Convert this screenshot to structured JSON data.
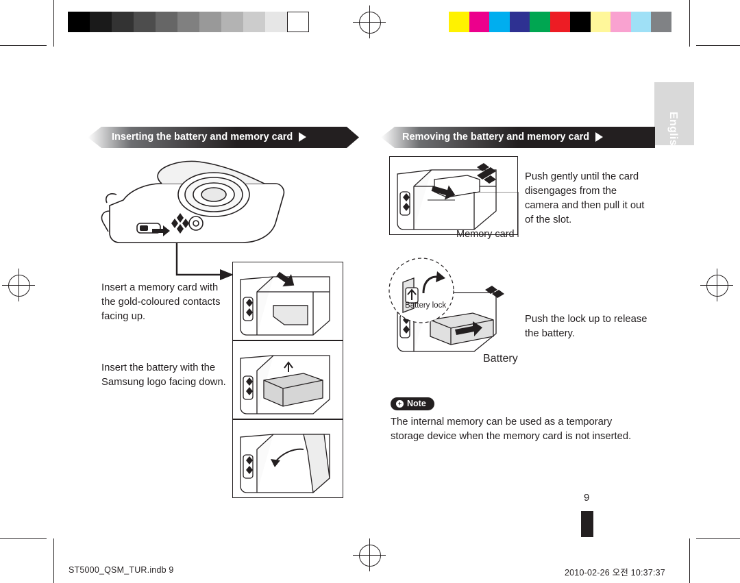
{
  "document": {
    "language_tab": "English",
    "page_number": "9",
    "footer_left": "ST5000_QSM_TUR.indb   9",
    "footer_right": "2010-02-26   오전 10:37:37"
  },
  "colorbars": {
    "grayscale": [
      "#000000",
      "#1a1a1a",
      "#333333",
      "#4d4d4d",
      "#666666",
      "#808080",
      "#999999",
      "#b3b3b3",
      "#cccccc",
      "#e6e6e6",
      "#ffffff"
    ],
    "color": [
      "#fff200",
      "#ec008c",
      "#00aeef",
      "#2e3192",
      "#00a651",
      "#ed1c24",
      "#000000",
      "#fff79a",
      "#f9a2d0",
      "#9fe0f6",
      "#808285"
    ]
  },
  "left_column": {
    "header": "Inserting the battery and memory card",
    "step1": "Insert a memory card with the gold-coloured contacts facing up.",
    "step2": "Insert the battery with the Samsung logo facing down."
  },
  "right_column": {
    "header": "Removing the battery and memory card",
    "step1": "Push gently until the card disengages from the camera and then pull it out of the slot.",
    "caption_memory_card": "Memory card",
    "caption_battery_lock": "Battery lock",
    "caption_battery": "Battery",
    "step2": "Push the lock up to release the battery.",
    "note_label": "Note",
    "note_icon": "+",
    "note_text": "The internal memory can be used as a temporary storage device when the memory card is not inserted."
  }
}
